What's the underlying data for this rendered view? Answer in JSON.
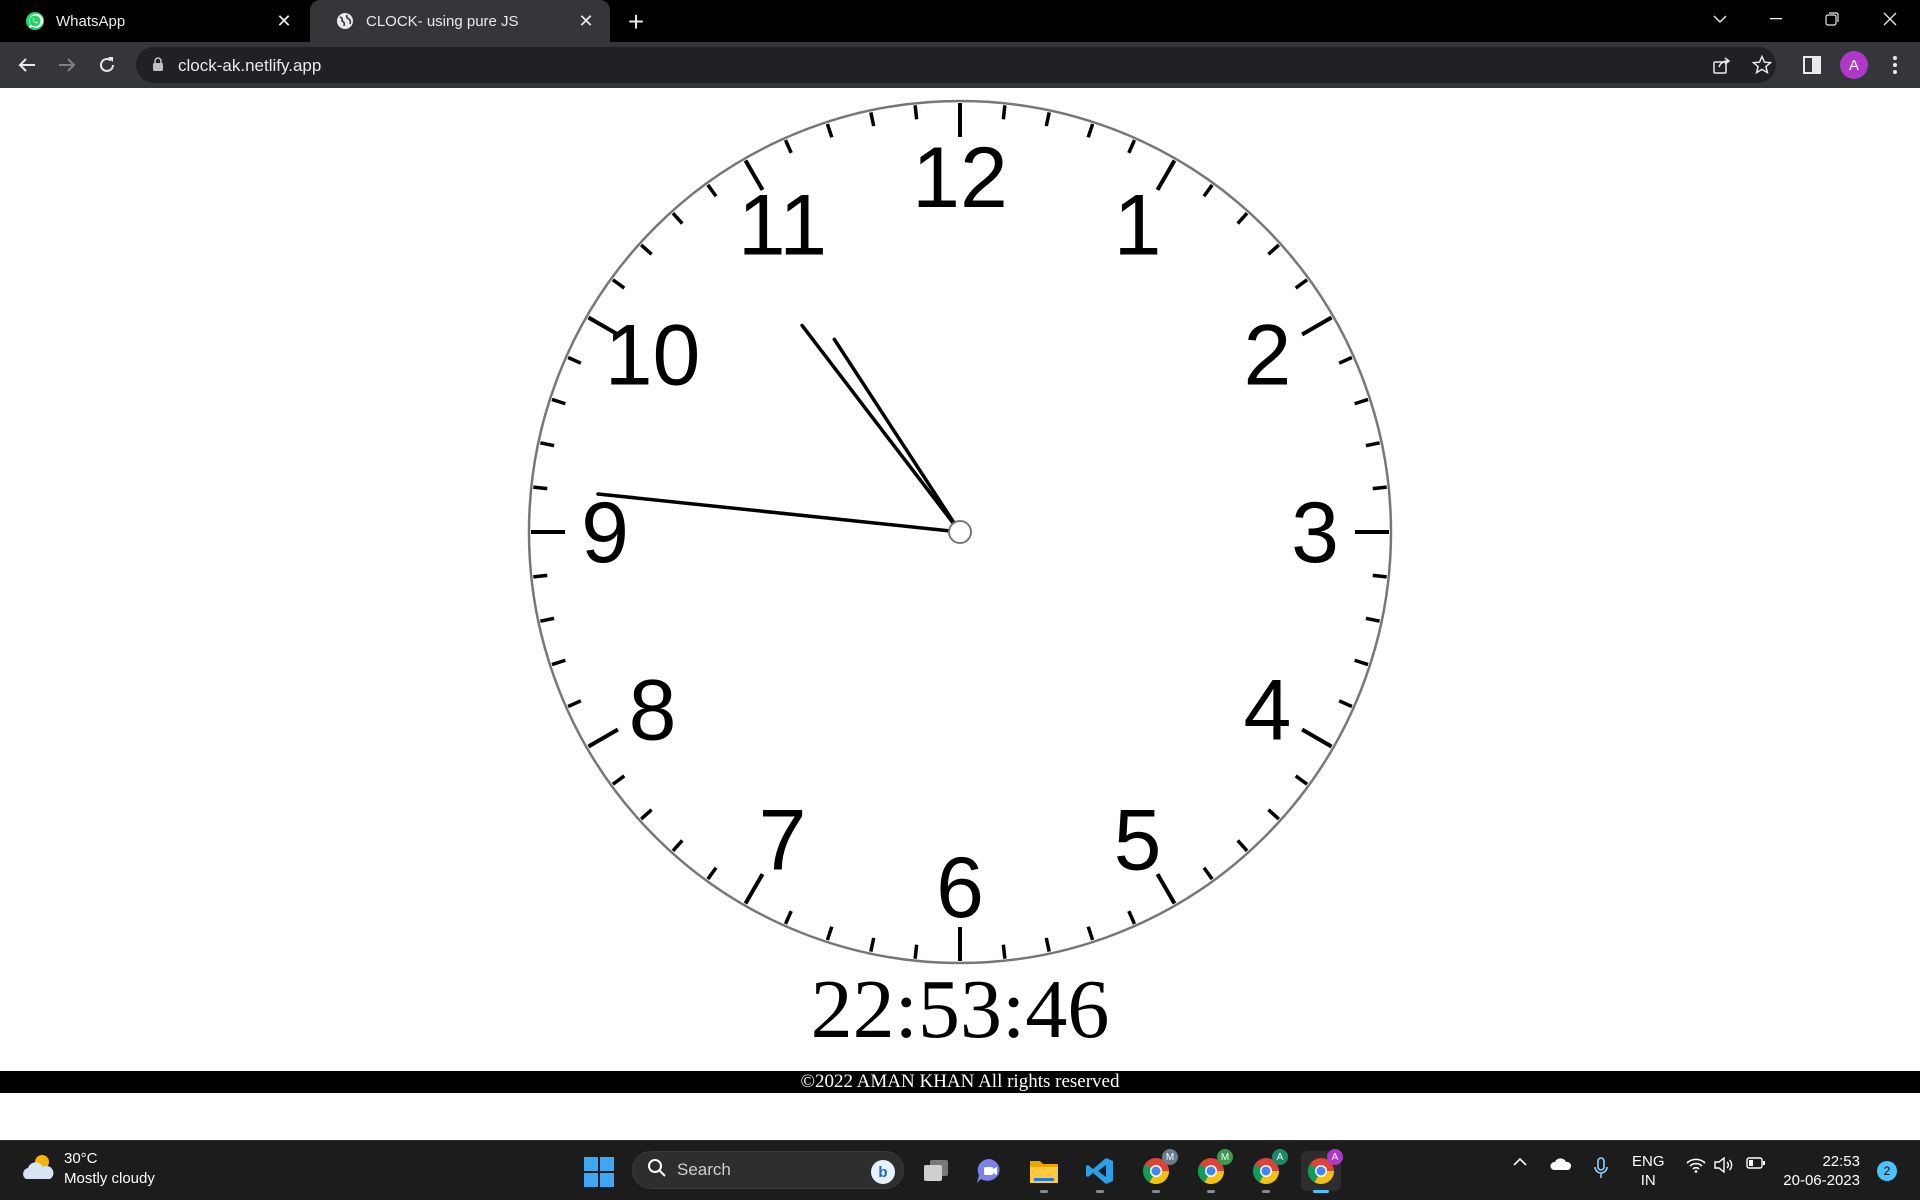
{
  "browser": {
    "tabs": [
      {
        "title": "WhatsApp",
        "icon": "whatsapp-icon",
        "active": false
      },
      {
        "title": "CLOCK- using pure JS",
        "icon": "globe-icon",
        "active": true
      }
    ],
    "url": "clock-ak.netlify.app",
    "profile_initial": "A"
  },
  "clock": {
    "numerals": [
      "12",
      "1",
      "2",
      "3",
      "4",
      "5",
      "6",
      "7",
      "8",
      "9",
      "10",
      "11"
    ],
    "time": {
      "hours": 22,
      "minutes": 53,
      "seconds": 46
    },
    "digital_time": "22:53:46",
    "footer": "©2022 AMAN KHAN All rights reserved"
  },
  "taskbar": {
    "weather": {
      "temp": "30°C",
      "condition": "Mostly cloudy"
    },
    "search_placeholder": "Search",
    "lang_line1": "ENG",
    "lang_line2": "IN",
    "time": "22:53",
    "date": "20-06-2023",
    "notification_count": "2"
  }
}
